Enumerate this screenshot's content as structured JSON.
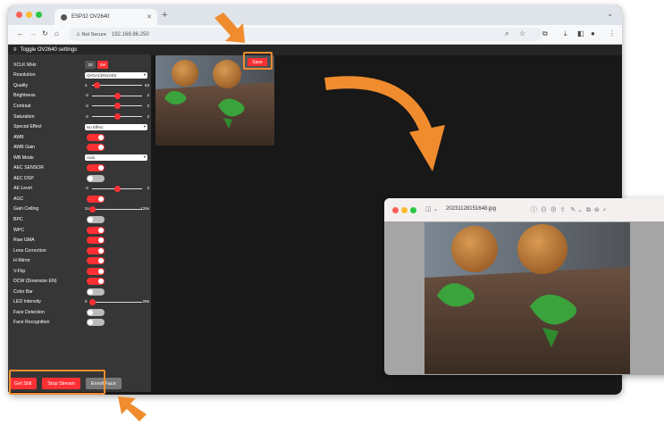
{
  "browser": {
    "tab_title": "ESP32 OV2640",
    "url_security": "Not Secure",
    "url_host": "192.168.86.250"
  },
  "app": {
    "toggle_title": "Toggle OV2640 settings"
  },
  "settings": {
    "xclk": {
      "label": "XCLK MHz",
      "value": "20",
      "set_label": "Set"
    },
    "resolution": {
      "label": "Resolution",
      "value": "QVGA(320x240)"
    },
    "quality": {
      "label": "Quality",
      "min": "4",
      "max": "63",
      "value": 10
    },
    "brightness": {
      "label": "Brightness",
      "min": "-2",
      "max": "2",
      "value": 0
    },
    "contrast": {
      "label": "Contrast",
      "min": "-2",
      "max": "2",
      "value": 0
    },
    "saturation": {
      "label": "Saturation",
      "min": "-2",
      "max": "2",
      "value": 0
    },
    "special_effect": {
      "label": "Special Effect",
      "value": "No Effect"
    },
    "awb": {
      "label": "AWB",
      "on": true
    },
    "awb_gain": {
      "label": "AWB Gain",
      "on": true
    },
    "wb_mode": {
      "label": "WB Mode",
      "value": "Auto"
    },
    "aec_sensor": {
      "label": "AEC SENSOR",
      "on": true
    },
    "aec_dsp": {
      "label": "AEC DSP",
      "on": false
    },
    "ae_level": {
      "label": "AE Level",
      "min": "-2",
      "max": "2",
      "value": 0
    },
    "agc": {
      "label": "AGC",
      "on": true
    },
    "gain_ceiling": {
      "label": "Gain Ceiling",
      "min": "2x",
      "max": "128x",
      "value": 0
    },
    "bpc": {
      "label": "BPC",
      "on": false
    },
    "wpc": {
      "label": "WPC",
      "on": true
    },
    "raw_gma": {
      "label": "Raw GMA",
      "on": true
    },
    "lens_correction": {
      "label": "Lens Correction",
      "on": true
    },
    "h_mirror": {
      "label": "H-Mirror",
      "on": true
    },
    "v_flip": {
      "label": "V-Flip",
      "on": true
    },
    "dcw": {
      "label": "DCW (Downsize EN)",
      "on": true
    },
    "color_bar": {
      "label": "Color Bar",
      "on": false
    },
    "led_intensity": {
      "label": "LED Intensity",
      "min": "0",
      "max": "255",
      "value": 0
    },
    "face_detection": {
      "label": "Face Detection",
      "on": false
    },
    "face_recognition": {
      "label": "Face Recognition",
      "on": false
    }
  },
  "buttons": {
    "get_still": "Get Still",
    "stop_stream": "Stop Stream",
    "enroll_face": "Enroll Face",
    "save": "Save"
  },
  "preview_window": {
    "filename": "20231128151648.jpg"
  },
  "colors": {
    "accent": "#ff3034",
    "highlight": "#f08c2e",
    "panel": "#363636",
    "background": "#181818"
  }
}
